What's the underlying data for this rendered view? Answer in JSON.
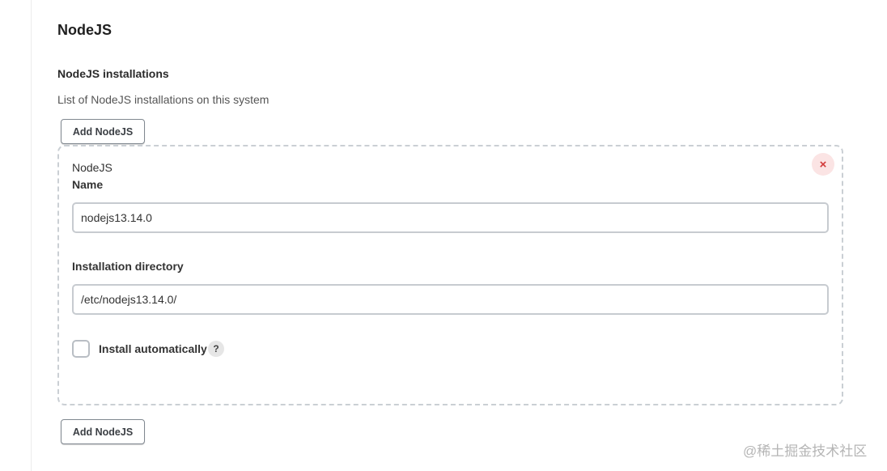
{
  "section": {
    "title": "NodeJS"
  },
  "installations": {
    "title": "NodeJS installations",
    "description": "List of NodeJS installations on this system",
    "add_label": "Add NodeJS",
    "item": {
      "type_label": "NodeJS",
      "close_icon": "×",
      "name_label": "Name",
      "name_value": "nodejs13.14.0",
      "dir_label": "Installation directory",
      "dir_value": "/etc/nodejs13.14.0/",
      "install_auto_label": "Install automatically",
      "install_auto_checked": false,
      "help_icon": "?"
    }
  },
  "watermark": "@稀土掘金技术社区"
}
